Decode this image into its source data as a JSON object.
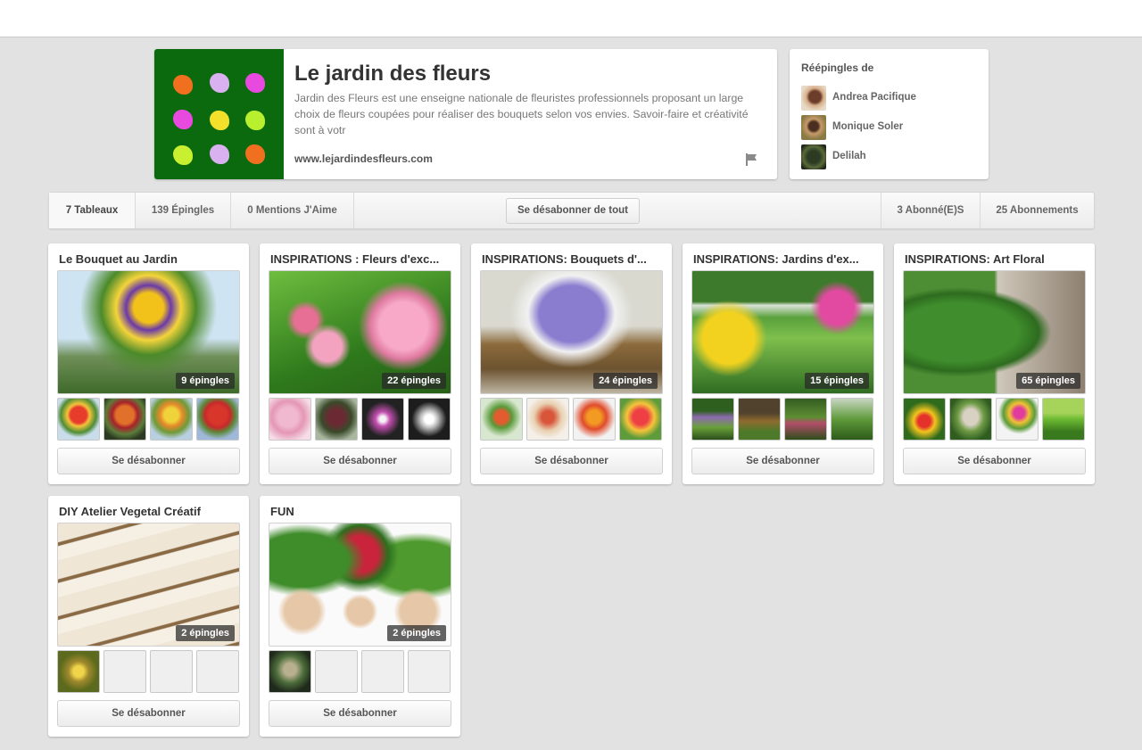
{
  "profile": {
    "name": "Le jardin des fleurs",
    "description": "Jardin des Fleurs est une enseigne nationale de fleuristes professionnels proposant un large choix de fleurs coupées pour réaliser des bouquets selon vos envies. Savoir-faire et créativité sont à votr",
    "url": "www.lejardindesfleurs.com",
    "logo_colors": [
      "#f07020",
      "#d9b0f0",
      "#e84ae0",
      "#e84ae0",
      "#f2e02a",
      "#b8f030",
      "#c8f030",
      "#d9b0f0",
      "#f07020"
    ]
  },
  "repins": {
    "title": "Réépingles de",
    "users": [
      {
        "name": "Andrea Pacifique"
      },
      {
        "name": "Monique Soler"
      },
      {
        "name": "Delilah"
      }
    ]
  },
  "nav": {
    "boards": "7 Tableaux",
    "pins": "139 Épingles",
    "likes": "0 Mentions J'Aime",
    "unfollow_all": "Se désabonner de tout",
    "followers": "3 Abonné(E)S",
    "following": "25 Abonnements"
  },
  "boards": [
    {
      "title": "Le Bouquet au Jardin",
      "count": "9 épingles",
      "button": "Se désabonner"
    },
    {
      "title": "INSPIRATIONS : Fleurs d'exc...",
      "count": "22 épingles",
      "button": "Se désabonner"
    },
    {
      "title": "INSPIRATIONS: Bouquets d'...",
      "count": "24 épingles",
      "button": "Se désabonner"
    },
    {
      "title": "INSPIRATIONS: Jardins d'ex...",
      "count": "15 épingles",
      "button": "Se désabonner"
    },
    {
      "title": "INSPIRATIONS: Art Floral",
      "count": "65 épingles",
      "button": "Se désabonner"
    },
    {
      "title": "DIY Atelier Vegetal Créatif",
      "count": "2 épingles",
      "button": "Se désabonner"
    },
    {
      "title": "FUN",
      "count": "2 épingles",
      "button": "Se désabonner"
    }
  ],
  "colors": {
    "background": "#e2e2e2",
    "logo_green": "#0c6a0e"
  }
}
